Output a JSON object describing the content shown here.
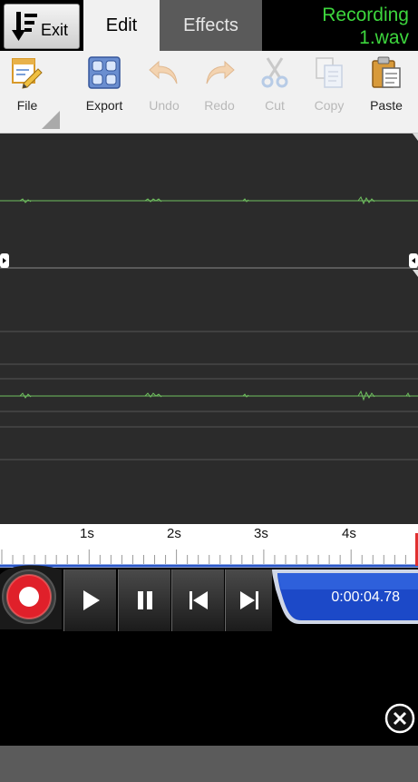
{
  "topbar": {
    "exit_label": "Exit",
    "tabs": [
      {
        "label": "Edit",
        "active": true
      },
      {
        "label": "Effects",
        "active": false
      }
    ],
    "file_title": "Recording\n1.wav",
    "title_color": "#3dd63d"
  },
  "toolbar": {
    "items": [
      {
        "label": "File",
        "icon": "file-edit-icon",
        "enabled": true
      },
      {
        "label": "Export",
        "icon": "export-icon",
        "enabled": true
      },
      {
        "label": "Undo",
        "icon": "undo-icon",
        "enabled": false
      },
      {
        "label": "Redo",
        "icon": "redo-icon",
        "enabled": false
      },
      {
        "label": "Cut",
        "icon": "scissors-icon",
        "enabled": false
      },
      {
        "label": "Copy",
        "icon": "copy-icon",
        "enabled": false
      },
      {
        "label": "Paste",
        "icon": "paste-icon",
        "enabled": true
      }
    ]
  },
  "timeline": {
    "ticks": [
      "1s",
      "2s",
      "3s",
      "4s"
    ]
  },
  "transport": {
    "time": "0:00:04.78"
  },
  "colors": {
    "waveform": "#6fbf5f",
    "record": "#e0202a",
    "time_panel": "#1c49c8"
  }
}
